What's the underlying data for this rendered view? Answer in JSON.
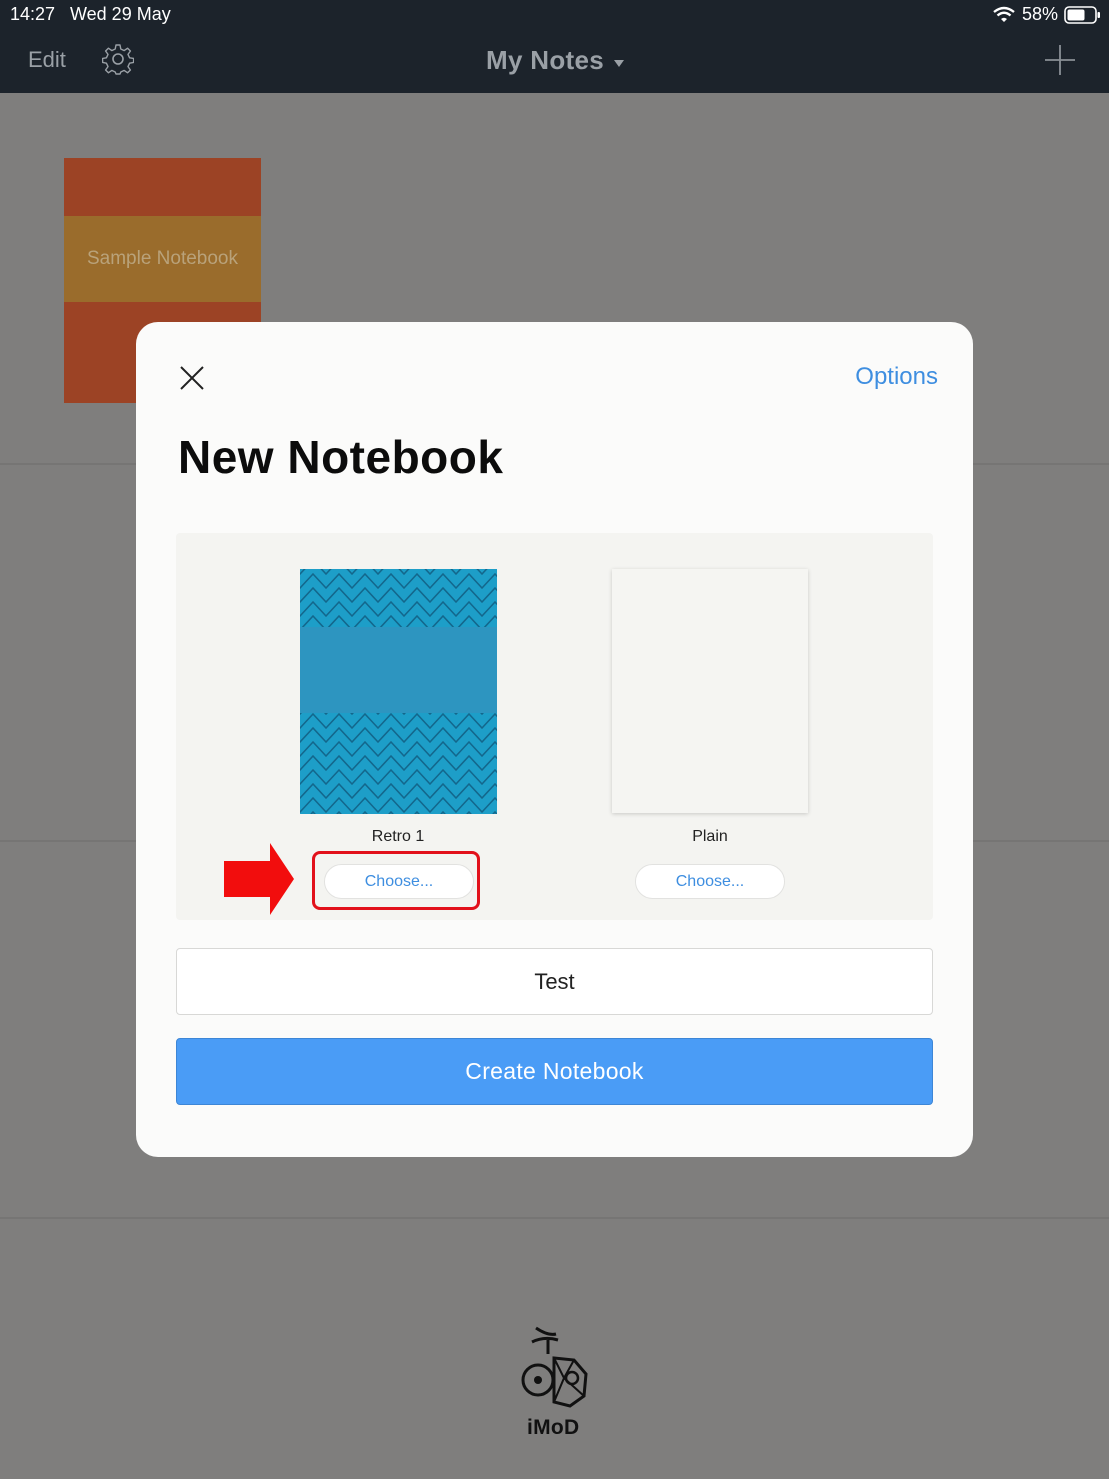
{
  "status_bar": {
    "time": "14:27",
    "date": "Wed 29 May",
    "battery": "58%"
  },
  "nav": {
    "edit_label": "Edit",
    "title": "My Notes",
    "icons": [
      "gear-icon",
      "chevron-down-icon",
      "plus-icon"
    ]
  },
  "library": {
    "notebooks": [
      {
        "title": "Sample Notebook",
        "cover_color": "#9c4325",
        "band_color": "#9a6c2c"
      }
    ]
  },
  "modal": {
    "options_label": "Options",
    "title": "New Notebook",
    "covers": [
      {
        "name": "Retro 1",
        "choose_label": "Choose...",
        "color": "#1d9ec8",
        "highlighted": true
      },
      {
        "name": "Plain",
        "choose_label": "Choose...",
        "color": "#f5f5f2",
        "highlighted": false
      }
    ],
    "name_value": "Test",
    "create_label": "Create Notebook"
  },
  "watermark": {
    "text": "iMoD"
  },
  "colors": {
    "accent": "#3e8ee0",
    "primary_button": "#4a9cf6",
    "highlight": "#e2111b",
    "top_bar": "#1c232b"
  }
}
